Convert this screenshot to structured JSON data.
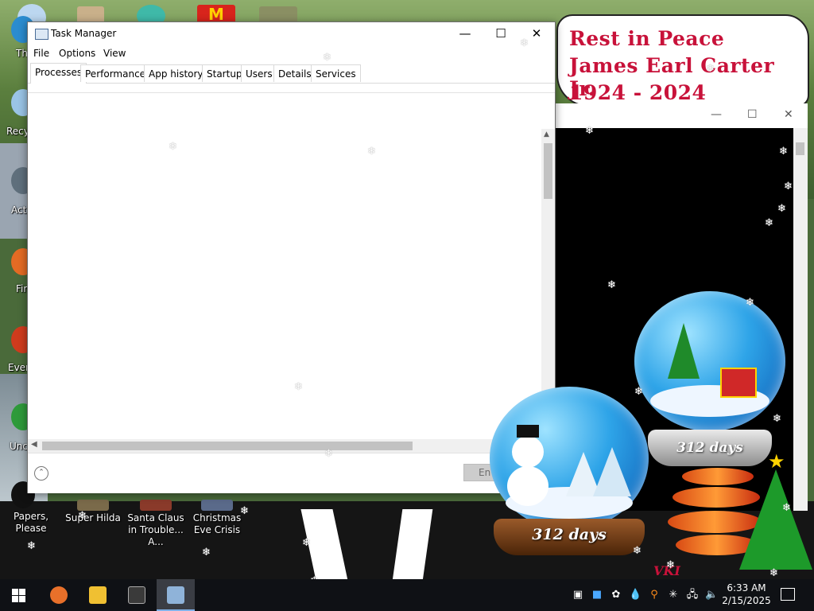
{
  "desktop": {
    "top_icons": [
      "",
      "",
      "",
      ""
    ],
    "left_icons": [
      {
        "label": "Th"
      },
      {
        "label": "Recy"
      },
      {
        "label": "Act"
      },
      {
        "label": "Fir"
      },
      {
        "label": "Ever"
      },
      {
        "label": "Unc"
      }
    ],
    "bottom_icons": [
      {
        "label": "Papers, Please"
      },
      {
        "label": "Super Hilda"
      },
      {
        "label": "Santa Claus in Trouble... A..."
      },
      {
        "label": "Christmas Eve Crisis"
      }
    ]
  },
  "banner": {
    "line1": "Rest in Peace",
    "line2": "James Earl Carter Jr.",
    "line3": "1924 - 2024",
    "color": "#c8123a"
  },
  "second_window": {
    "minimize": "—",
    "maximize": "☐",
    "close": "✕"
  },
  "countdown": {
    "big_globe_label": "312 days",
    "small_globe_label": "312 days",
    "partial_text": "VKI"
  },
  "task_manager": {
    "title": "Task Manager",
    "controls": {
      "minimize": "—",
      "maximize": "☐",
      "close": "✕"
    },
    "menu": [
      "File",
      "Options",
      "View"
    ],
    "tabs": [
      {
        "label": "Processes",
        "active": true
      },
      {
        "label": "Performance",
        "active": false
      },
      {
        "label": "App history",
        "active": false
      },
      {
        "label": "Startup",
        "active": false
      },
      {
        "label": "Users",
        "active": false
      },
      {
        "label": "Details",
        "active": false
      },
      {
        "label": "Services",
        "active": false
      }
    ],
    "end_task_button": "En",
    "expand_icon": "⌃"
  },
  "taskbar": {
    "start_icon": "windows-logo",
    "apps": [
      {
        "name": "firefox-icon",
        "color": "#e8702a"
      },
      {
        "name": "file-explorer-icon",
        "color": "#f0c032"
      },
      {
        "name": "terminal-icon",
        "color": "#3a3a3a"
      },
      {
        "name": "task-manager-icon",
        "color": "#8fb3d9"
      }
    ],
    "tray": [
      "▣",
      "■",
      "✿",
      "💧",
      "⚲",
      "✳",
      "🖧",
      "🔈"
    ],
    "time": "6:33 AM",
    "date": "2/15/2025"
  },
  "snowflake_glyph": "❄"
}
